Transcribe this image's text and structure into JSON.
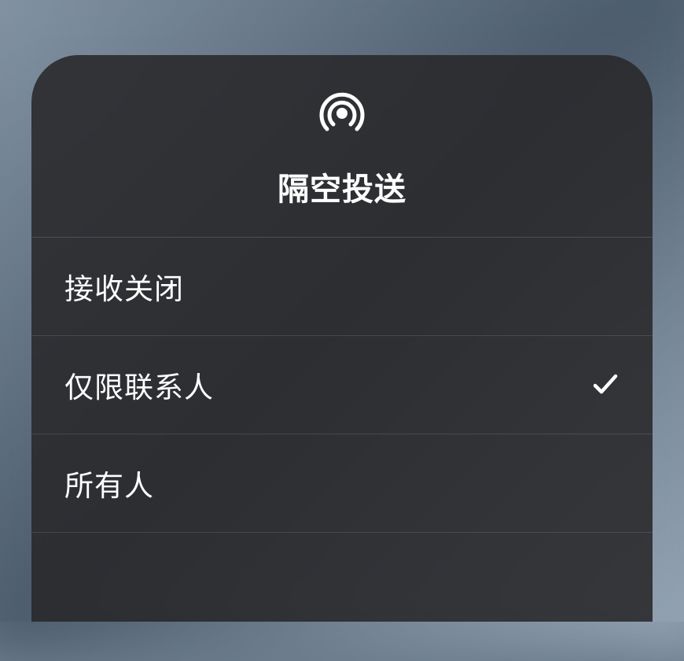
{
  "title": "隔空投送",
  "icon": "airdrop-icon",
  "options": [
    {
      "label": "接收关闭",
      "selected": false
    },
    {
      "label": "仅限联系人",
      "selected": true
    },
    {
      "label": "所有人",
      "selected": false
    }
  ]
}
